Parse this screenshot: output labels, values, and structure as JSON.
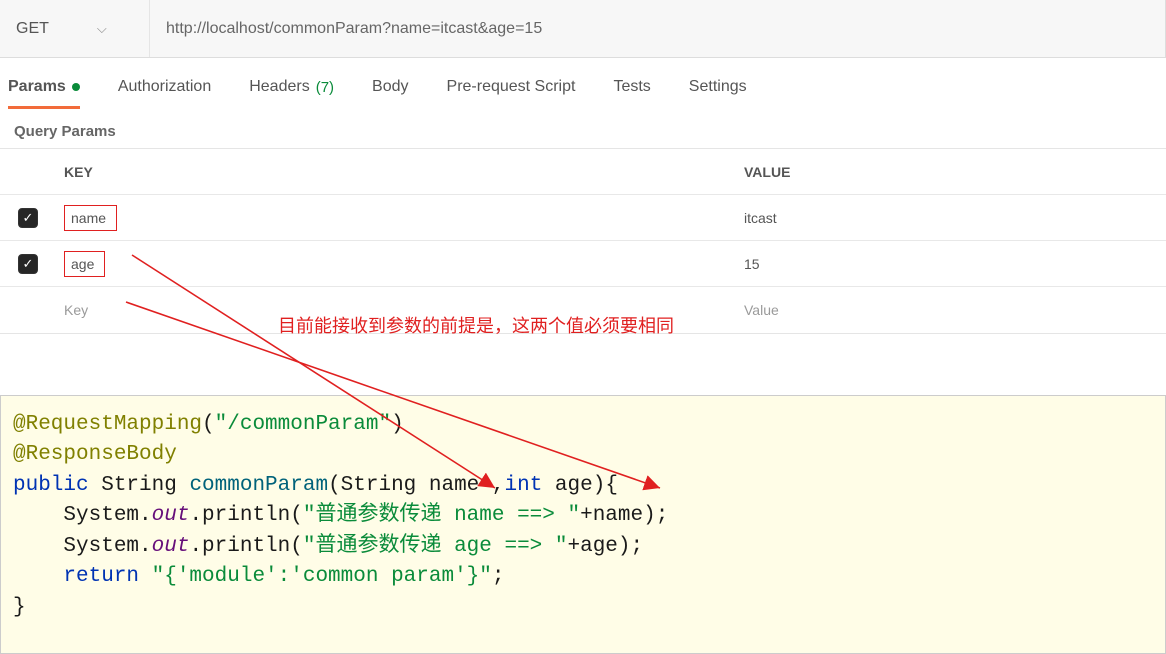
{
  "request": {
    "method": "GET",
    "url": "http://localhost/commonParam?name=itcast&age=15"
  },
  "tabs": [
    {
      "label": "Params",
      "active": true,
      "has_dot": true
    },
    {
      "label": "Authorization"
    },
    {
      "label": "Headers",
      "count": "(7)"
    },
    {
      "label": "Body"
    },
    {
      "label": "Pre-request Script"
    },
    {
      "label": "Tests"
    },
    {
      "label": "Settings"
    }
  ],
  "section_label": "Query Params",
  "headers": {
    "key": "KEY",
    "value": "VALUE"
  },
  "params": [
    {
      "checked": true,
      "key": "name",
      "value": "itcast"
    },
    {
      "checked": true,
      "key": "age",
      "value": "15"
    }
  ],
  "placeholders": {
    "key": "Key",
    "value": "Value"
  },
  "annotation_text": "目前能接收到参数的前提是，这两个值必须要相同",
  "code": {
    "l1a": "@RequestMapping",
    "l1b": "(",
    "l1c": "\"/commonParam\"",
    "l1d": ")",
    "l2": "@ResponseBody",
    "l3a": "public ",
    "l3b": "String ",
    "l3c": "commonParam",
    "l3d": "(String name ,",
    "l3e": "int ",
    "l3f": "age){",
    "l4a": "    System.",
    "l4b": "out",
    "l4c": ".println(",
    "l4d": "\"普通参数传递 name ==> \"",
    "l4e": "+name);",
    "l5d": "\"普通参数传递 age ==> \"",
    "l5e": "+age);",
    "l6a": "    return ",
    "l6b": "\"{'module':'common param'}\"",
    "l6c": ";",
    "l7": "}"
  }
}
